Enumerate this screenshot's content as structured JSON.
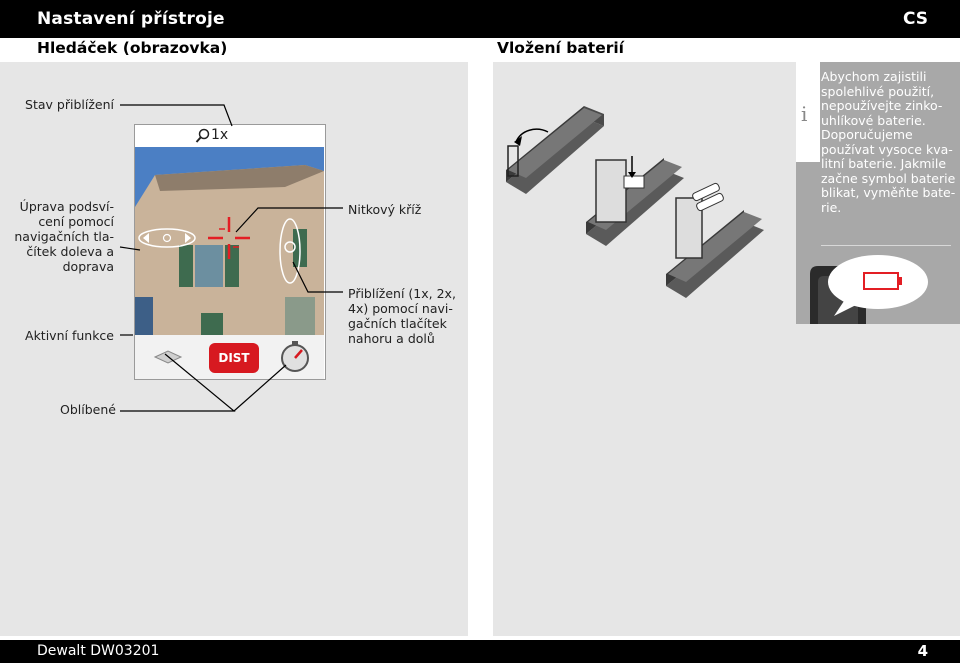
{
  "header": {
    "title": "Nastavení přístroje",
    "lang": "CS"
  },
  "left": {
    "heading": "Hledáček (obrazovka)",
    "callouts": {
      "zoom_state": "Stav přiblížení",
      "backlight": "Úprava podsví-\ncení pomocí\nnavigačních tla-\nčítek doleva a\ndoprava",
      "active_function": "Aktivní funkce",
      "crosshair": "Nitkový kříž",
      "zoom": "Přiblížení (1x, 2x,\n4x) pomocí navi-\ngačních tlačítek\nnahoru a dolů",
      "favorites": "Oblíbené"
    },
    "device": {
      "zoom_label": "1x",
      "dist_label": "DIST"
    }
  },
  "right": {
    "heading": "Vložení baterií",
    "info": "Abychom zajistili spolehlivé použití, nepoužívejte zinko-uhlíkové baterie. Doporučujeme používat vysoce kva-litní baterie. Jakmile začne symbol baterie blikat, vyměňte bate-rie."
  },
  "footer": {
    "model": "Dewalt DW03201",
    "page": "4"
  },
  "colors": {
    "bar": "#000000",
    "panel": "#e6e6e6",
    "info_box": "#a8a8a8",
    "crosshair": "#e31e24",
    "dist_button": "#d71920"
  }
}
